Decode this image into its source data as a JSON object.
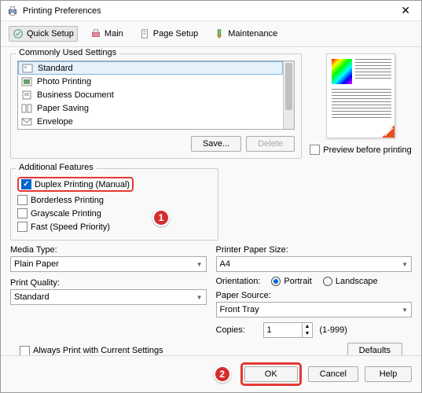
{
  "title": "Printing Preferences",
  "tabs": {
    "quick_setup": "Quick Setup",
    "main": "Main",
    "page_setup": "Page Setup",
    "maintenance": "Maintenance"
  },
  "groups": {
    "common": "Commonly Used Settings",
    "features": "Additional Features"
  },
  "settings": {
    "items": [
      "Standard",
      "Photo Printing",
      "Business Document",
      "Paper Saving",
      "Envelope"
    ]
  },
  "buttons": {
    "save": "Save...",
    "delete": "Delete",
    "defaults": "Defaults",
    "ok": "OK",
    "cancel": "Cancel",
    "help": "Help"
  },
  "preview_checkbox": "Preview before printing",
  "features": {
    "duplex": "Duplex Printing (Manual)",
    "borderless": "Borderless Printing",
    "grayscale": "Grayscale Printing",
    "fast": "Fast (Speed Priority)"
  },
  "labels": {
    "media_type": "Media Type:",
    "print_quality": "Print Quality:",
    "paper_size": "Printer Paper Size:",
    "orientation": "Orientation:",
    "portrait": "Portrait",
    "landscape": "Landscape",
    "paper_source": "Paper Source:",
    "copies": "Copies:",
    "copies_range": "(1-999)",
    "always_print": "Always Print with Current Settings"
  },
  "values": {
    "media_type": "Plain Paper",
    "print_quality": "Standard",
    "paper_size": "A4",
    "paper_source": "Front Tray",
    "copies": "1"
  },
  "badges": {
    "one": "1",
    "two": "2"
  }
}
